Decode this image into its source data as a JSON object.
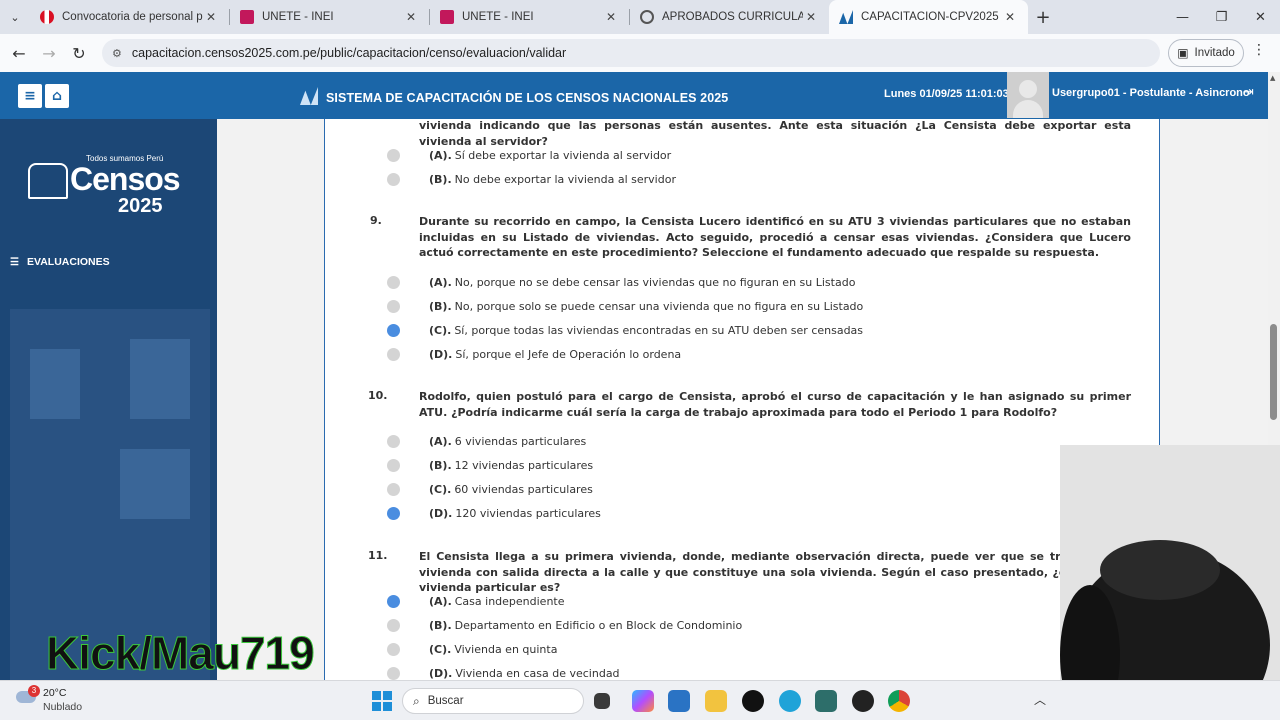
{
  "browser": {
    "tabs": [
      {
        "title": "Convocatoria de personal para",
        "active": false
      },
      {
        "title": "UNETE - INEI",
        "active": false
      },
      {
        "title": "UNETE - INEI",
        "active": false
      },
      {
        "title": "APROBADOS CURRICULAR CON",
        "active": false
      },
      {
        "title": "CAPACITACION-CPV2025",
        "active": true
      }
    ],
    "url": "capacitacion.censos2025.com.pe/public/capacitacion/censo/evaluacion/validar",
    "guest_label": "Invitado"
  },
  "header": {
    "title": "SISTEMA DE CAPACITACIÓN DE LOS CENSOS NACIONALES 2025",
    "datetime": "Lunes 01/09/25 11:01:03",
    "user": "Usergrupo01 - Postulante - Asincrono"
  },
  "sidebar": {
    "brand_tagline": "Todos sumamos Perú",
    "brand_name": "Censos",
    "brand_year": "2025",
    "menu_item": "EVALUACIONES"
  },
  "questions": [
    {
      "number": "",
      "text": "vivienda indicando que las personas están ausentes. Ante esta situación ¿La Censista debe exportar esta vivienda al servidor?",
      "options": [
        {
          "letter": "(A).",
          "text": "Sí debe exportar la vivienda al servidor",
          "selected": false
        },
        {
          "letter": "(B).",
          "text": "No debe exportar la vivienda al servidor",
          "selected": false
        }
      ]
    },
    {
      "number": "9.",
      "text": "Durante su recorrido en campo, la Censista Lucero identificó en su ATU 3 viviendas particulares que no estaban incluidas en su Listado de viviendas. Acto seguido, procedió a censar esas viviendas. ¿Considera que Lucero actuó correctamente en este procedimiento? Seleccione el fundamento adecuado que respalde su respuesta.",
      "options": [
        {
          "letter": "(A).",
          "text": "No, porque no se debe censar las viviendas que no figuran en su Listado",
          "selected": false
        },
        {
          "letter": "(B).",
          "text": "No, porque solo se puede censar una vivienda que no figura en su Listado",
          "selected": false
        },
        {
          "letter": "(C).",
          "text": "Sí, porque todas las viviendas encontradas en su ATU deben ser censadas",
          "selected": true
        },
        {
          "letter": "(D).",
          "text": "Sí, porque el Jefe de Operación lo ordena",
          "selected": false
        }
      ]
    },
    {
      "number": "10.",
      "text": "Rodolfo, quien postuló para el cargo de Censista, aprobó el curso de capacitación y le han asignado su primer ATU. ¿Podría indicarme cuál sería la carga de trabajo aproximada para todo el Periodo 1 para Rodolfo?",
      "options": [
        {
          "letter": "(A).",
          "text": "6 viviendas particulares",
          "selected": false
        },
        {
          "letter": "(B).",
          "text": "12 viviendas particulares",
          "selected": false
        },
        {
          "letter": "(C).",
          "text": "60 viviendas particulares",
          "selected": false
        },
        {
          "letter": "(D).",
          "text": "120 viviendas particulares",
          "selected": true
        }
      ]
    },
    {
      "number": "11.",
      "text": "El Censista llega a su primera vivienda, donde, mediante observación directa, puede ver que se trata de una vivienda con salida directa a la calle y que constituye una sola vivienda. Según el caso presentado, ¿qué tipo de vivienda particular es?",
      "options": [
        {
          "letter": "(A).",
          "text": "Casa independiente",
          "selected": true
        },
        {
          "letter": "(B).",
          "text": "Departamento en Edificio o en Block de Condominio",
          "selected": false
        },
        {
          "letter": "(C).",
          "text": "Vivienda en quinta",
          "selected": false
        },
        {
          "letter": "(D).",
          "text": "Vivienda en casa de vecindad",
          "selected": false
        }
      ]
    }
  ],
  "overlay": {
    "watermark": "Kick/Mau719"
  },
  "taskbar": {
    "temperature": "20°C",
    "condition": "Nublado",
    "weather_badge": "3",
    "search_placeholder": "Buscar"
  },
  "colors": {
    "header_blue": "#1b66a8",
    "sidebar_blue": "#1c4776",
    "radio_selected": "#4a8de0",
    "radio_unselected": "#d4d4d4"
  }
}
